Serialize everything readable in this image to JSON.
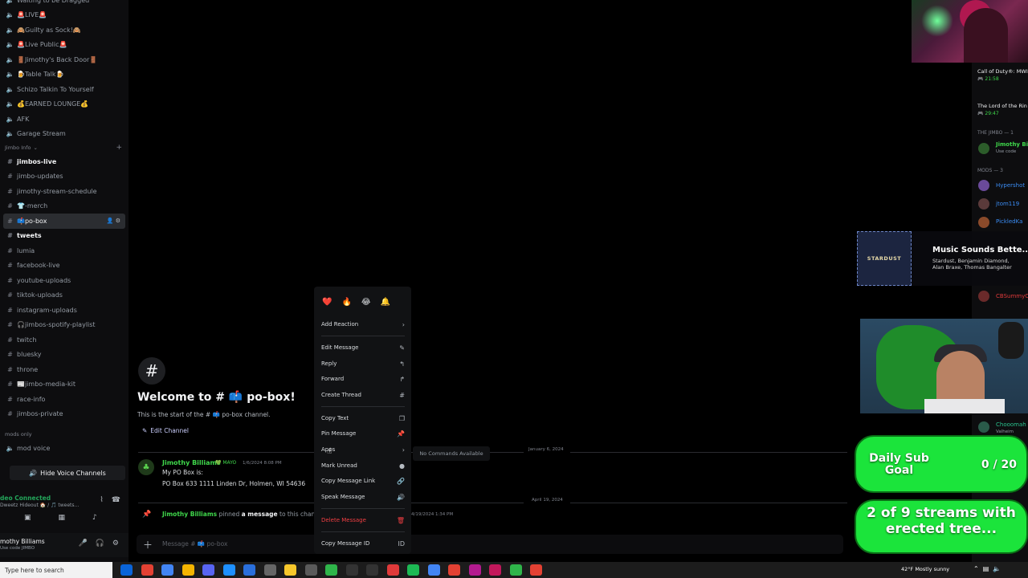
{
  "sidebar": {
    "voice_channels": [
      {
        "label": "Waiting to be Dragged"
      },
      {
        "label": "🚨LIVE🚨"
      },
      {
        "label": "🙈Guilty as Sock!🙈"
      },
      {
        "label": "🚨Live Public🚨"
      },
      {
        "label": "🚪Jimothy's Back Door🚪"
      },
      {
        "label": "🍺Table Talk🍺"
      },
      {
        "label": "Schizo Talkin To Yourself"
      },
      {
        "label": "💰EARNED LOUNGE💰"
      },
      {
        "label": "AFK"
      },
      {
        "label": "Garage Stream"
      }
    ],
    "category_label": "Jimbo Info",
    "text_channels": [
      {
        "label": "jimbos-live",
        "bold": true
      },
      {
        "label": "jimbo-updates"
      },
      {
        "label": "jimothy-stream-schedule"
      },
      {
        "label": "👕-merch"
      },
      {
        "label": "📫po-box",
        "active": true
      },
      {
        "label": "tweets",
        "bold": true
      },
      {
        "label": "lumia"
      },
      {
        "label": "facebook-live"
      },
      {
        "label": "youtube-uploads"
      },
      {
        "label": "tiktok-uploads"
      },
      {
        "label": "instagram-uploads"
      },
      {
        "label": "🎧jimbos-spotify-playlist"
      },
      {
        "label": "twitch"
      },
      {
        "label": "bluesky"
      },
      {
        "label": "throne"
      },
      {
        "label": "📰jimbo-media-kit"
      },
      {
        "label": "race-info"
      },
      {
        "label": "jimbos-private"
      }
    ],
    "mods_category": "mods only",
    "mod_voice": "mod voice",
    "hide_voice_label": "Hide Voice Channels",
    "voice_status": "deo Connected",
    "voice_sub": "Dweetz Hideout 🏠 / 🎵 tweets...",
    "user_name": "mothy Billiams",
    "user_status": "Use code JIMBO"
  },
  "main": {
    "welcome_title": "Welcome to # 📫 po-box!",
    "welcome_sub": "This is the start of the # 📫 po-box channel.",
    "edit_channel": "Edit Channel",
    "date1": "January 6, 2024",
    "date2": "April 19, 2024",
    "message": {
      "author": "Jimothy Billiams",
      "badge": "💚 MAYO",
      "time": "1/6/2024 8:08 PM",
      "line1": "My PO Box is:",
      "line2": "PO Box 633 1111 Linden Dr, Holmen, WI 54636"
    },
    "pin": {
      "who": "Jimothy Billiams",
      "pinned": " pinned ",
      "msg": "a message",
      "rest": " to this channel.",
      "time": "4/19/2024 1:34 PM"
    },
    "composer_placeholder": "Message # 📫 po-box"
  },
  "context_menu": {
    "reactions": [
      "❤️",
      "🔥",
      "😂",
      "🔔"
    ],
    "items": [
      {
        "label": "Add Reaction",
        "icon": "chevron-right-icon",
        "glyph": "›"
      },
      {
        "label": "Edit Message",
        "icon": "pencil-icon",
        "glyph": "✎"
      },
      {
        "label": "Reply",
        "icon": "reply-icon",
        "glyph": "↰"
      },
      {
        "label": "Forward",
        "icon": "forward-icon",
        "glyph": "↱"
      },
      {
        "label": "Create Thread",
        "icon": "thread-icon",
        "glyph": "#"
      },
      {
        "label": "Copy Text",
        "icon": "copy-icon",
        "glyph": "❐"
      },
      {
        "label": "Pin Message",
        "icon": "pin-icon",
        "glyph": "📌"
      },
      {
        "label": "Apps",
        "icon": "chevron-right-icon",
        "glyph": "›"
      },
      {
        "label": "Mark Unread",
        "icon": "mark-unread-icon",
        "glyph": "●"
      },
      {
        "label": "Copy Message Link",
        "icon": "link-icon",
        "glyph": "🔗"
      },
      {
        "label": "Speak Message",
        "icon": "speaker-icon",
        "glyph": "🔊"
      },
      {
        "label": "Delete Message",
        "icon": "trash-icon",
        "glyph": "🗑"
      },
      {
        "label": "Copy Message ID",
        "icon": "id-icon",
        "glyph": "ID"
      }
    ],
    "submenu_text": "No Commands Available"
  },
  "members": {
    "activity1_game": "Call of Duty®: MWII",
    "activity1_time": "🎮 21:58",
    "activity2_game": "The Lord of the Rin",
    "activity2_time": "🎮 29:47",
    "group1": "THE JIMBO — 1",
    "owner_name": "Jimothy Bi",
    "owner_status": "Use code",
    "group2": "MODS — 3",
    "mods": [
      "Hypershot",
      "jtom119",
      "PickledKa"
    ],
    "extra": [
      "CBSummyC",
      "Chooomah"
    ],
    "extra_sub": "Valheim"
  },
  "overlay": {
    "album_art_text": "STARDUST",
    "song_title": "Music Sounds Bette...",
    "song_artists": "Stardust, Benjamin Diamond, Alan Braxe, Thomas Bangalter",
    "sub_goal_label": "Daily Sub Goal",
    "sub_goal_count": "0 / 20",
    "tree_goal_label": "2 of 9 streams with erected tree..."
  },
  "taskbar": {
    "search_placeholder": "Type here to search",
    "weather": "42°F Mostly sunny"
  },
  "colors": {
    "accent_green": "#1be43b",
    "author_green": "#3fd74b",
    "danger_red": "#f23f43"
  }
}
